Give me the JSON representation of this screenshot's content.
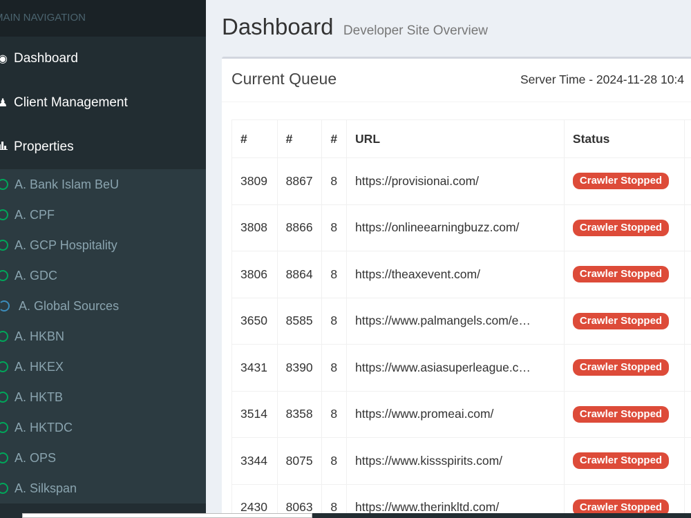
{
  "sidebar": {
    "header": "MAIN NAVIGATION",
    "items": [
      {
        "label": "Dashboard",
        "icon": "dashboard-icon"
      },
      {
        "label": "Client Management",
        "icon": "users-icon"
      },
      {
        "label": "Properties",
        "icon": "bar-chart-icon"
      }
    ],
    "properties": [
      {
        "label": "A. Bank Islam BeU",
        "status": "green"
      },
      {
        "label": "A. CPF",
        "status": "green"
      },
      {
        "label": "A. GCP Hospitality",
        "status": "green"
      },
      {
        "label": "A. GDC",
        "status": "green"
      },
      {
        "label": "A. Global Sources",
        "status": "loading"
      },
      {
        "label": "A. HKBN",
        "status": "green"
      },
      {
        "label": "A. HKEX",
        "status": "green"
      },
      {
        "label": "A. HKTB",
        "status": "green"
      },
      {
        "label": "A. HKTDC",
        "status": "green"
      },
      {
        "label": "A. OPS",
        "status": "green"
      },
      {
        "label": "A. Silkspan",
        "status": "green"
      }
    ]
  },
  "header": {
    "title": "Dashboard",
    "subtitle": "Developer Site Overview"
  },
  "queue": {
    "title": "Current Queue",
    "server_time": "Server Time - 2024-11-28 10:4",
    "columns": [
      "#",
      "#",
      "#",
      "URL",
      "Status"
    ],
    "rows": [
      {
        "a": "3809",
        "b": "8867",
        "c": "8",
        "url": "https://provisionai.com/",
        "status": "Crawler Stopped"
      },
      {
        "a": "3808",
        "b": "8866",
        "c": "8",
        "url": "https://onlineearningbuzz.com/",
        "status": "Crawler Stopped"
      },
      {
        "a": "3806",
        "b": "8864",
        "c": "8",
        "url": "https://theaxevent.com/",
        "status": "Crawler Stopped"
      },
      {
        "a": "3650",
        "b": "8585",
        "c": "8",
        "url": "https://www.palmangels.com/e…",
        "status": "Crawler Stopped"
      },
      {
        "a": "3431",
        "b": "8390",
        "c": "8",
        "url": "https://www.asiasuperleague.c…",
        "status": "Crawler Stopped"
      },
      {
        "a": "3514",
        "b": "8358",
        "c": "8",
        "url": "https://www.promeai.com/",
        "status": "Crawler Stopped"
      },
      {
        "a": "3344",
        "b": "8075",
        "c": "8",
        "url": "https://www.kissspirits.com/",
        "status": "Crawler Stopped"
      },
      {
        "a": "2430",
        "b": "8063",
        "c": "8",
        "url": "https://www.therinkltd.com/",
        "status": "Crawler Stopped"
      }
    ]
  },
  "colors": {
    "sidebar_bg": "#222d32",
    "badge_red": "#dd4b39",
    "status_green": "#00a65a",
    "status_blue": "#3c8dbc"
  }
}
